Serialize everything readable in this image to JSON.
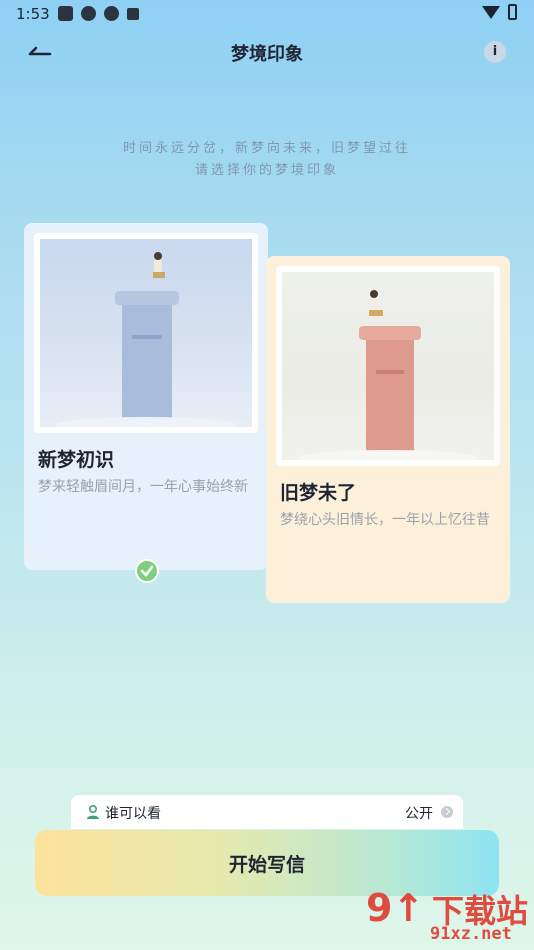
{
  "status_bar": {
    "time": "1:53"
  },
  "header": {
    "title": "梦境印象"
  },
  "subtitle": {
    "line1": "时间永远分岔，新梦向未来，旧梦望过往",
    "line2": "请选择你的梦境印象"
  },
  "cards": [
    {
      "name": "新梦初识",
      "description": "梦来轻触眉间月，一年心事始终新",
      "selected": true
    },
    {
      "name": "旧梦未了",
      "description": "梦绕心头旧情长，一年以上忆往昔",
      "selected": false
    }
  ],
  "visibility": {
    "label": "谁可以看",
    "value": "公开"
  },
  "start_button": {
    "label": "开始写信"
  },
  "watermark": {
    "title": "下载站",
    "url": "91xz.net"
  },
  "colors": {
    "accent_check": "#7fd07e",
    "card_new_bg": "#e6f1fc",
    "card_old_bg": "#fdf0da",
    "watermark": "#e04b3f"
  }
}
